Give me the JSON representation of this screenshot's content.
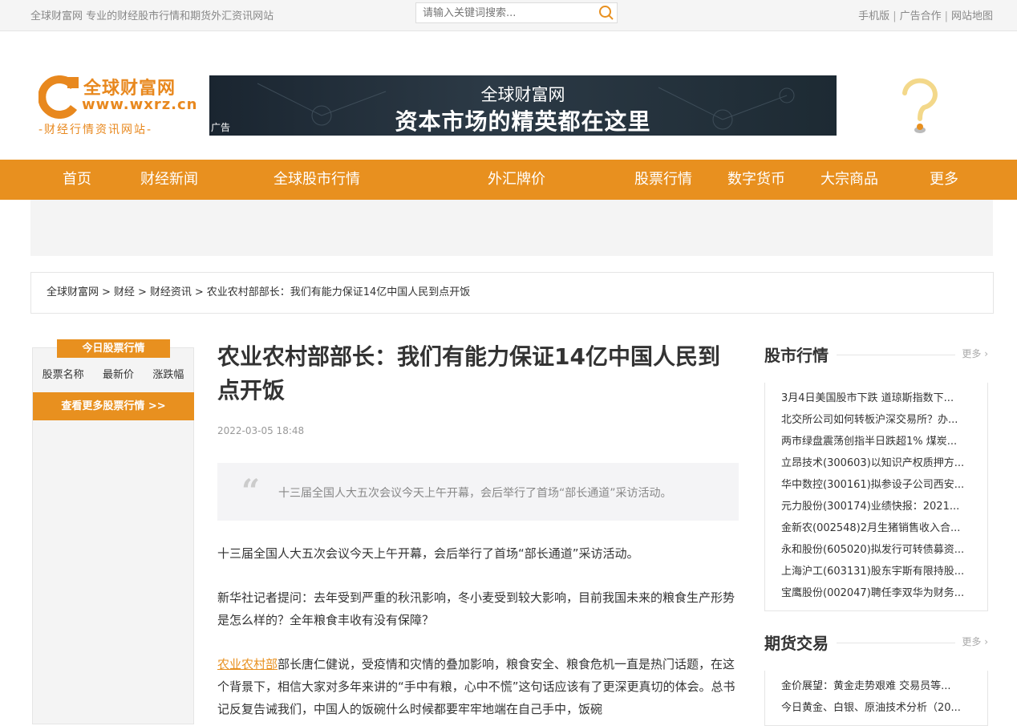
{
  "topbar": {
    "slogan": "全球财富网 专业的财经股市行情和期货外汇资讯网站",
    "search_placeholder": "请输入关键词搜索...",
    "links": [
      "手机版",
      "广告合作",
      "网站地图"
    ]
  },
  "logo": {
    "name": "全球财富网",
    "url": "www.wxrz.cn",
    "tagline": "-财经行情资讯网站-"
  },
  "banner": {
    "line1": "全球财富网",
    "line2": "资本市场的精英都在这里",
    "ad_label": "广告"
  },
  "nav": [
    "首页",
    "财经新闻",
    "全球股市行情",
    "外汇牌价",
    "股票行情",
    "数字货币",
    "大宗商品",
    "更多"
  ],
  "breadcrumb": [
    "全球财富网",
    "财经",
    "财经资讯",
    "农业农村部部长：我们有能力保证14亿中国人民到点开饭"
  ],
  "left_sidebar": {
    "title": "今日股票行情",
    "columns": [
      "股票名称",
      "最新价",
      "涨跌幅"
    ],
    "more": "查看更多股票行情 >>"
  },
  "article": {
    "title": "农业农村部部长：我们有能力保证14亿中国人民到点开饭",
    "date": "2022-03-05 18:48",
    "quote": "十三届全国人大五次会议今天上午开幕，会后举行了首场“部长通道”采访活动。",
    "p1": "十三届全国人大五次会议今天上午开幕，会后举行了首场“部长通道”采访活动。",
    "p2": "新华社记者提问：去年受到严重的秋汛影响，冬小麦受到较大影响，目前我国未来的粮食生产形势是怎么样的？全年粮食丰收有没有保障？",
    "p3_link": "农业农村部",
    "p3_rest": "部长唐仁健说，受疫情和灾情的叠加影响，粮食安全、粮食危机一直是热门话题，在这个背景下，相信大家对多年来讲的“手中有粮，心中不慌”这句话应该有了更深更真切的体会。总书记反复告诫我们，中国人的饭碗什么时候都要牢牢地端在自己手中，饭碗"
  },
  "stock_box": {
    "title": "股市行情",
    "more": "更多",
    "items": [
      "3月4日美国股市下跌 道琼斯指数下...",
      "北交所公司如何转板沪深交易所？办...",
      "两市绿盘震荡创指半日跌超1% 煤炭...",
      "立昂技术(300603)以知识产权质押方...",
      "华中数控(300161)拟参设子公司西安...",
      "元力股份(300174)业绩快报：2021...",
      "金新农(002548)2月生猪销售收入合...",
      "永和股份(605020)拟发行可转债募资...",
      "上海沪工(603131)股东宇斯有限持股...",
      "宝鹰股份(002047)聘任李双华为财务..."
    ]
  },
  "futures_box": {
    "title": "期货交易",
    "more": "更多",
    "items": [
      "金价展望：黄金走势艰难 交易员等...",
      "今日黄金、白银、原油技术分析（20..."
    ]
  }
}
